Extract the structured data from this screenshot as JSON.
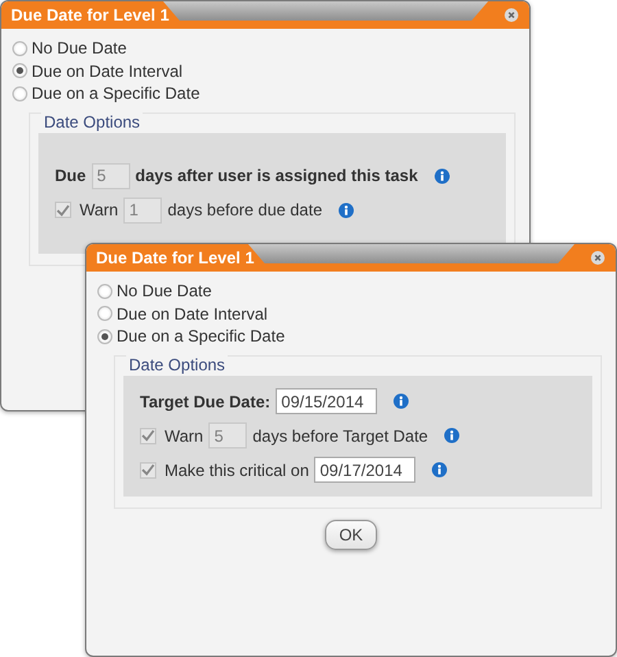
{
  "dialogs": [
    {
      "title": "Due Date for Level 1",
      "options": [
        {
          "label": "No Due Date",
          "selected": false
        },
        {
          "label": "Due on Date Interval",
          "selected": true
        },
        {
          "label": "Due on a Specific Date",
          "selected": false
        }
      ],
      "section": "Date Options",
      "rows": [
        {
          "kind": "number",
          "label": "Due",
          "value": "5",
          "suffix": "days after user is assigned this task"
        },
        {
          "kind": "check-number",
          "checked": true,
          "label": "Warn",
          "value": "1",
          "suffix": "days before due date"
        }
      ]
    },
    {
      "title": "Due Date for Level 1",
      "options": [
        {
          "label": "No Due Date",
          "selected": false
        },
        {
          "label": "Due on Date Interval",
          "selected": false
        },
        {
          "label": "Due on a Specific Date",
          "selected": true
        }
      ],
      "section": "Date Options",
      "rows": [
        {
          "kind": "date",
          "label": "Target Due Date:",
          "value": "09/15/2014"
        },
        {
          "kind": "check-number",
          "checked": true,
          "label": "Warn",
          "value": "5",
          "suffix": "days before Target Date"
        },
        {
          "kind": "check-date",
          "checked": true,
          "label": "Make this critical on",
          "value": "09/17/2014"
        }
      ],
      "button": "OK"
    }
  ]
}
